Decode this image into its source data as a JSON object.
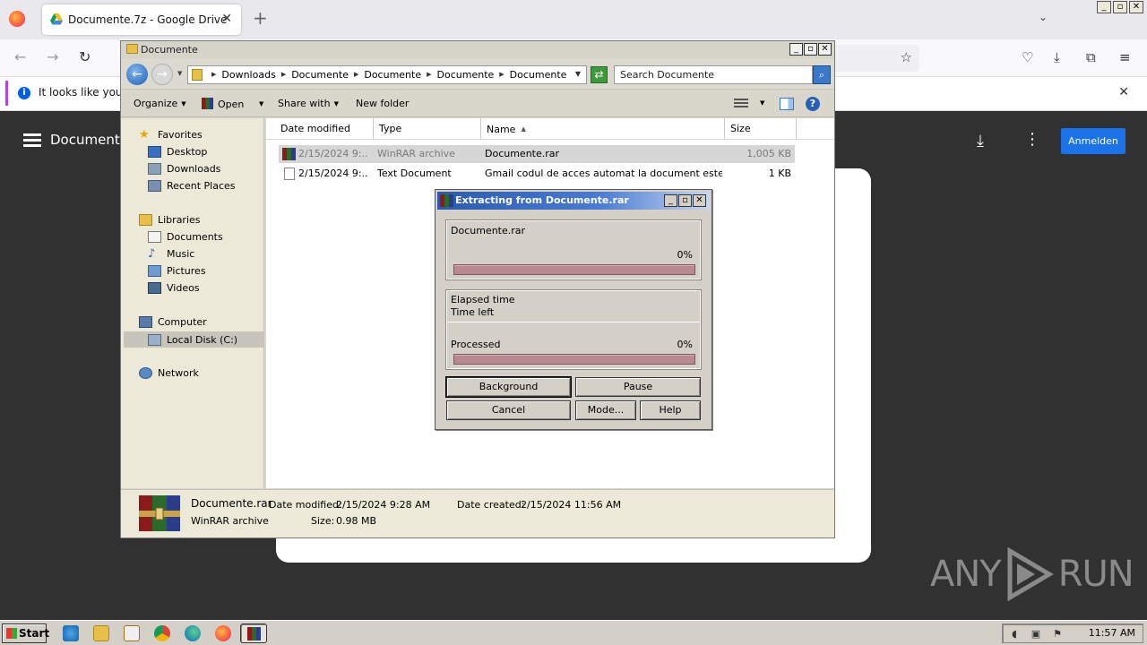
{
  "browser": {
    "tab_title": "Documente.7z - Google Drive",
    "tab_close": "✕",
    "new_tab": "+",
    "infobar_message": "It looks like you ha",
    "infobar_close": "✕",
    "window_buttons": [
      "_",
      "▫",
      "✕"
    ]
  },
  "drive": {
    "doc_title": "Document",
    "signin_label": "Anmelden",
    "watermark_left": "ANY",
    "watermark_right": "RUN"
  },
  "explorer": {
    "window_title": "Documente",
    "breadcrumb": [
      "Downloads",
      "Documente",
      "Documente",
      "Documente",
      "Documente"
    ],
    "search_placeholder": "Search Documente",
    "toolbar": {
      "organize": "Organize",
      "open": "Open",
      "share_with": "Share with",
      "new_folder": "New folder",
      "help": "?"
    },
    "nav": {
      "favorites": "Favorites",
      "desktop": "Desktop",
      "downloads": "Downloads",
      "recent_places": "Recent Places",
      "libraries": "Libraries",
      "documents": "Documents",
      "music": "Music",
      "pictures": "Pictures",
      "videos": "Videos",
      "computer": "Computer",
      "local_disk": "Local Disk (C:)",
      "network": "Network"
    },
    "columns": {
      "date_modified": "Date modified",
      "type": "Type",
      "name": "Name",
      "size": "Size"
    },
    "files": [
      {
        "date": "2/15/2024 9:...",
        "type": "WinRAR archive",
        "name": "Documente.rar",
        "size": "1,005 KB",
        "selected": true
      },
      {
        "date": "2/15/2024 9:...",
        "type": "Text Document",
        "name": "Gmail codul de acces automat la document este set...",
        "size": "1 KB",
        "selected": false
      }
    ],
    "details": {
      "name": "Documente.rar",
      "type": "WinRAR archive",
      "date_modified_label": "Date modified:",
      "date_modified": "2/15/2024 9:28 AM",
      "date_created_label": "Date created:",
      "date_created": "2/15/2024 11:56 AM",
      "size_label": "Size:",
      "size": "0.98 MB"
    }
  },
  "winrar": {
    "title": "Extracting from Documente.rar",
    "file": "Documente.rar",
    "file_percent": "0%",
    "elapsed_label": "Elapsed time",
    "time_left_label": "Time left",
    "processed_label": "Processed",
    "processed_percent": "0%",
    "progress_fraction": 0,
    "buttons": {
      "background": "Background",
      "pause": "Pause",
      "cancel": "Cancel",
      "mode": "Mode...",
      "help": "Help"
    }
  },
  "taskbar": {
    "start": "Start",
    "clock": "11:57 AM"
  }
}
